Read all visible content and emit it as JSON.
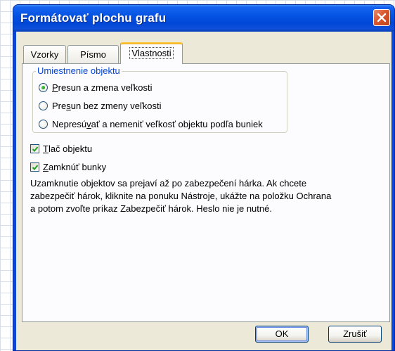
{
  "window": {
    "title": "Formátovať plochu grafu"
  },
  "tabs": [
    {
      "label": "Vzorky"
    },
    {
      "label": "Písmo"
    },
    {
      "label": "Vlastnosti"
    }
  ],
  "placement_group": {
    "legend": "Umiestnenie objektu",
    "options": [
      {
        "label_pre": "",
        "label_u": "P",
        "label_post": "resun a zmena veľkosti",
        "selected": true
      },
      {
        "label_pre": "Pre",
        "label_u": "s",
        "label_post": "un bez zmeny veľkosti",
        "selected": false
      },
      {
        "label_pre": "Nepresú",
        "label_u": "v",
        "label_post": "ať a nemeniť veľkosť objektu podľa buniek",
        "selected": false
      }
    ]
  },
  "checkboxes": [
    {
      "label_u": "T",
      "label_post": "lač objektu",
      "checked": true
    },
    {
      "label_u": "Z",
      "label_post": "amknúť bunky",
      "checked": true
    }
  ],
  "description": {
    "line1": "Uzamknutie objektov sa prejaví až po zabezpečení hárka. Ak chcete",
    "line2": "zabezpečiť hárok, kliknite na ponuku Nástroje, ukážte na položku Ochrana",
    "line3": "a potom zvoľte príkaz Zabezpečiť hárok. Heslo nie je nutné."
  },
  "buttons": {
    "ok": "OK",
    "cancel": "Zrušiť"
  }
}
